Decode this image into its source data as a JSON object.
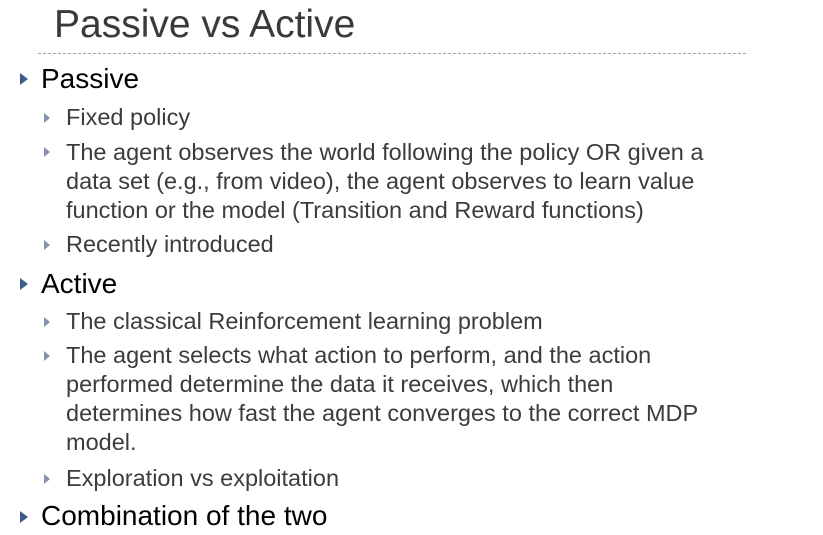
{
  "slide": {
    "title": "Passive vs Active",
    "sections": [
      {
        "label": "Passive",
        "items": [
          {
            "lines": [
              "Fixed policy"
            ]
          },
          {
            "lines": [
              "The agent observes the world following the policy OR given a",
              "data set (e.g., from video), the agent observes to learn value",
              "function or the model (Transition and Reward functions)"
            ]
          },
          {
            "lines": [
              "Recently introduced"
            ]
          }
        ]
      },
      {
        "label": "Active",
        "items": [
          {
            "lines": [
              "The classical Reinforcement learning problem"
            ]
          },
          {
            "lines": [
              "The agent selects what action to perform, and the action",
              "performed determine the data it receives, which then",
              "determines how fast the agent converges to the correct MDP",
              "model."
            ]
          },
          {
            "lines": [
              "Exploration vs exploitation"
            ]
          }
        ]
      },
      {
        "label": "Combination of the two",
        "items": []
      }
    ]
  },
  "colors": {
    "title": "#3a3a3a",
    "level1_bullet": "#3e5d8a",
    "level2_bullet": "#8593ad",
    "rule": "#9aa7bc"
  }
}
